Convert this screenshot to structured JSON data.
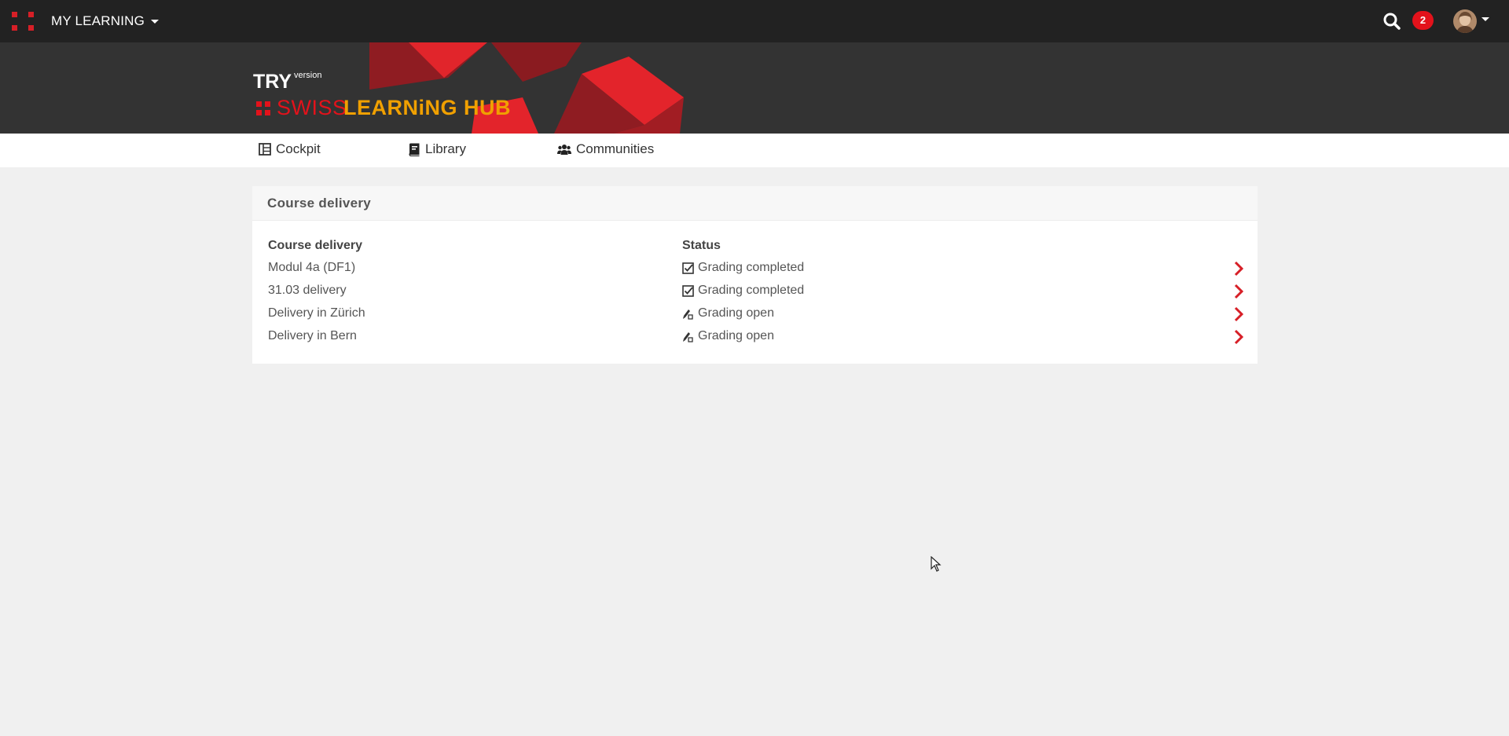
{
  "topbar": {
    "menu_title": "MY LEARNING",
    "notification_count": "2",
    "accent_color": "#e3121b"
  },
  "banner": {
    "try_label": "TRY",
    "version_label": "version",
    "brand_swiss": "SWISS",
    "brand_hub": "LEARNiNG HUB"
  },
  "nav": {
    "items": [
      {
        "label": "Cockpit",
        "icon": "cockpit-icon"
      },
      {
        "label": "Library",
        "icon": "library-icon"
      },
      {
        "label": "Communities",
        "icon": "communities-icon"
      }
    ]
  },
  "panel": {
    "title": "Course delivery",
    "columns": {
      "delivery": "Course delivery",
      "status": "Status"
    },
    "rows": [
      {
        "delivery": "Modul 4a (DF1)",
        "status": "Grading completed",
        "status_icon": "checkbox-checked-icon"
      },
      {
        "delivery": "31.03 delivery",
        "status": "Grading completed",
        "status_icon": "checkbox-checked-icon"
      },
      {
        "delivery": "Delivery in Zürich",
        "status": "Grading open",
        "status_icon": "grading-open-icon"
      },
      {
        "delivery": "Delivery in Bern",
        "status": "Grading open",
        "status_icon": "grading-open-icon"
      }
    ]
  }
}
